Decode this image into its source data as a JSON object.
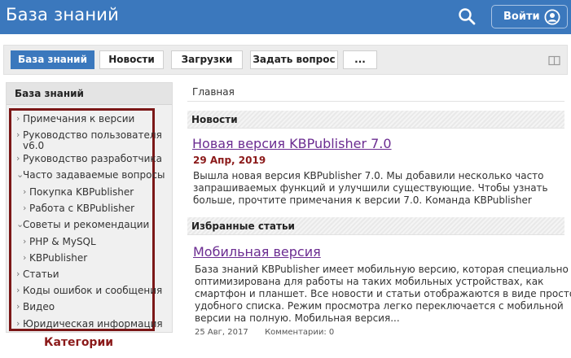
{
  "header": {
    "title": "База знаний",
    "search_icon": "search-icon",
    "login_label": "Войти",
    "user_icon": "user-icon",
    "bg_color": "#3b78bd"
  },
  "tabs": [
    {
      "label": "База знаний",
      "active": true
    },
    {
      "label": "Новости",
      "active": false
    },
    {
      "label": "Загрузки",
      "active": false
    },
    {
      "label": "Задать вопрос",
      "active": false
    },
    {
      "label": "...",
      "active": false
    }
  ],
  "sidebar": {
    "header": "База знаний",
    "items": [
      {
        "label": "Примечания к версии",
        "expanded": false
      },
      {
        "label": "Руководство пользователя",
        "label2": "v6.0",
        "expanded": false
      },
      {
        "label": "Руководство разработчика",
        "expanded": false
      },
      {
        "label": "Часто задаваемые вопросы",
        "expanded": true
      },
      {
        "label": "Покупка KBPublisher",
        "child": true
      },
      {
        "label": "Работа с KBPublisher",
        "child": true
      },
      {
        "label": "Советы и рекомендации",
        "expanded": true
      },
      {
        "label": "PHP & MySQL",
        "child": true
      },
      {
        "label": "KBPublisher",
        "child": true
      },
      {
        "label": "Статьи",
        "expanded": false
      },
      {
        "label": "Коды ошибок и сообщения",
        "expanded": false
      },
      {
        "label": "Видео",
        "expanded": false
      },
      {
        "label": "Юридическая информация",
        "expanded": false
      }
    ],
    "caption": "Категории"
  },
  "main": {
    "breadcrumb": "Главная",
    "news_header": "Новости",
    "news": {
      "title": "Новая версия KBPublisher 7.0",
      "date": "29 Апр, 2019",
      "lines": [
        "Вышла новая версия KBPublisher 7.0. Мы добавили несколько часто",
        "запрашиваемых функций и улучшили существующие. Чтобы узнать",
        "больше, прочтите примечания к версии 7.0. Команда KBPublisher"
      ]
    },
    "featured_header": "Избранные статьи",
    "article": {
      "title": "Мобильная версия",
      "lines": [
        "База знаний KBPublisher имеет мобильную версию, которая специально",
        "оптимизирована для работы на таких мобильных устройствах, как",
        "смартфон и планшет. Все новости и статьи отображаются в виде простого",
        "удобного списка. Режим просмотра легко переключается с мобильной",
        "версии на полную. Мобильная версия..."
      ],
      "date": "25 Авг, 2017",
      "comments": "Комментарии: 0"
    }
  }
}
